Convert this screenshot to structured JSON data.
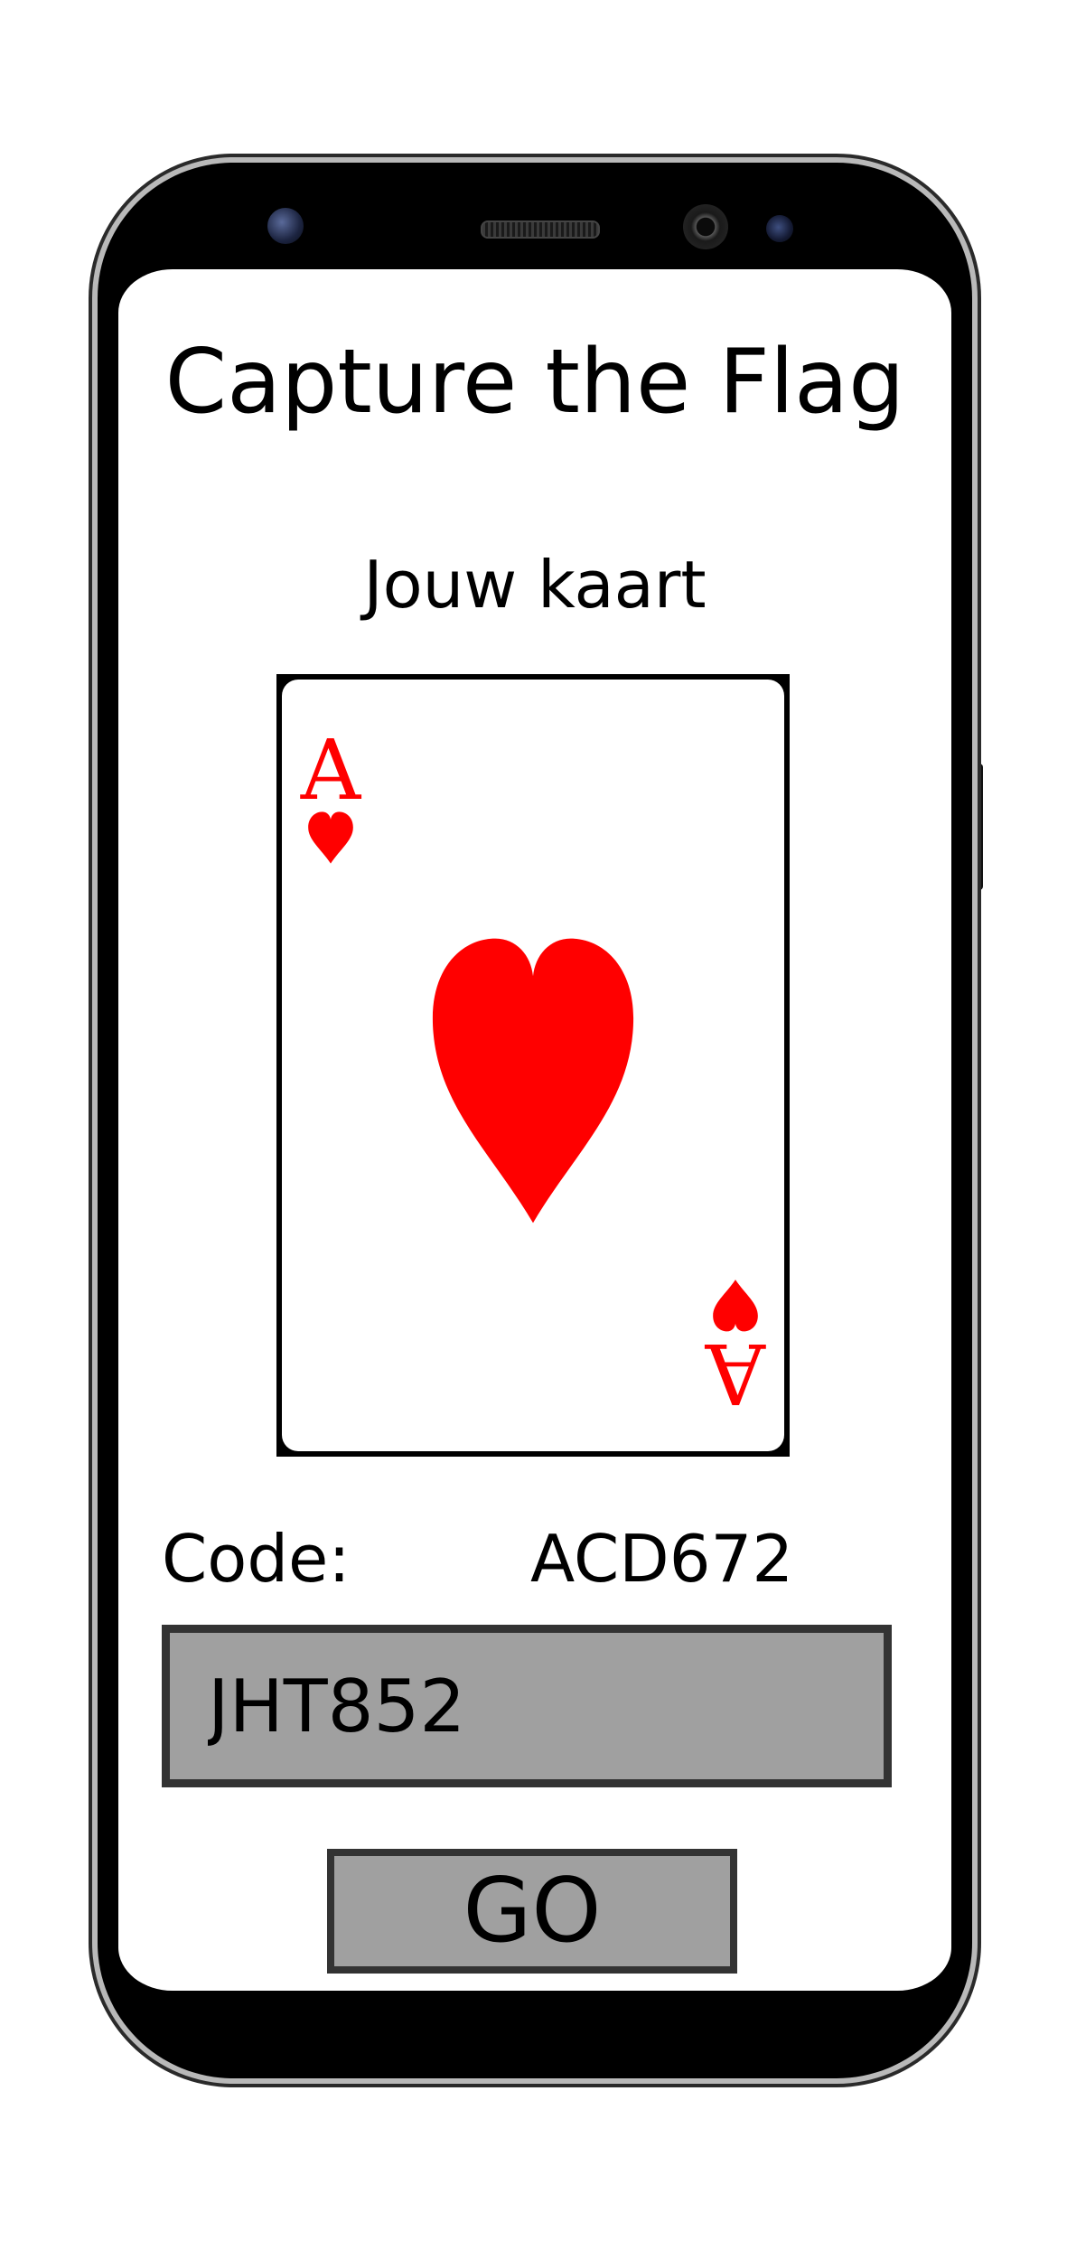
{
  "app": {
    "title": "Capture the Flag",
    "subtitle": "Jouw kaart"
  },
  "card": {
    "rank": "A",
    "suit": "heart-icon",
    "suit_color": "#ff0000"
  },
  "code": {
    "label": "Code:",
    "value": "ACD672"
  },
  "input": {
    "value": "JHT852"
  },
  "go_button": {
    "label": "GO"
  },
  "colors": {
    "input_background": "#a0a0a0",
    "input_border": "#333333",
    "phone_body": "#000000"
  }
}
